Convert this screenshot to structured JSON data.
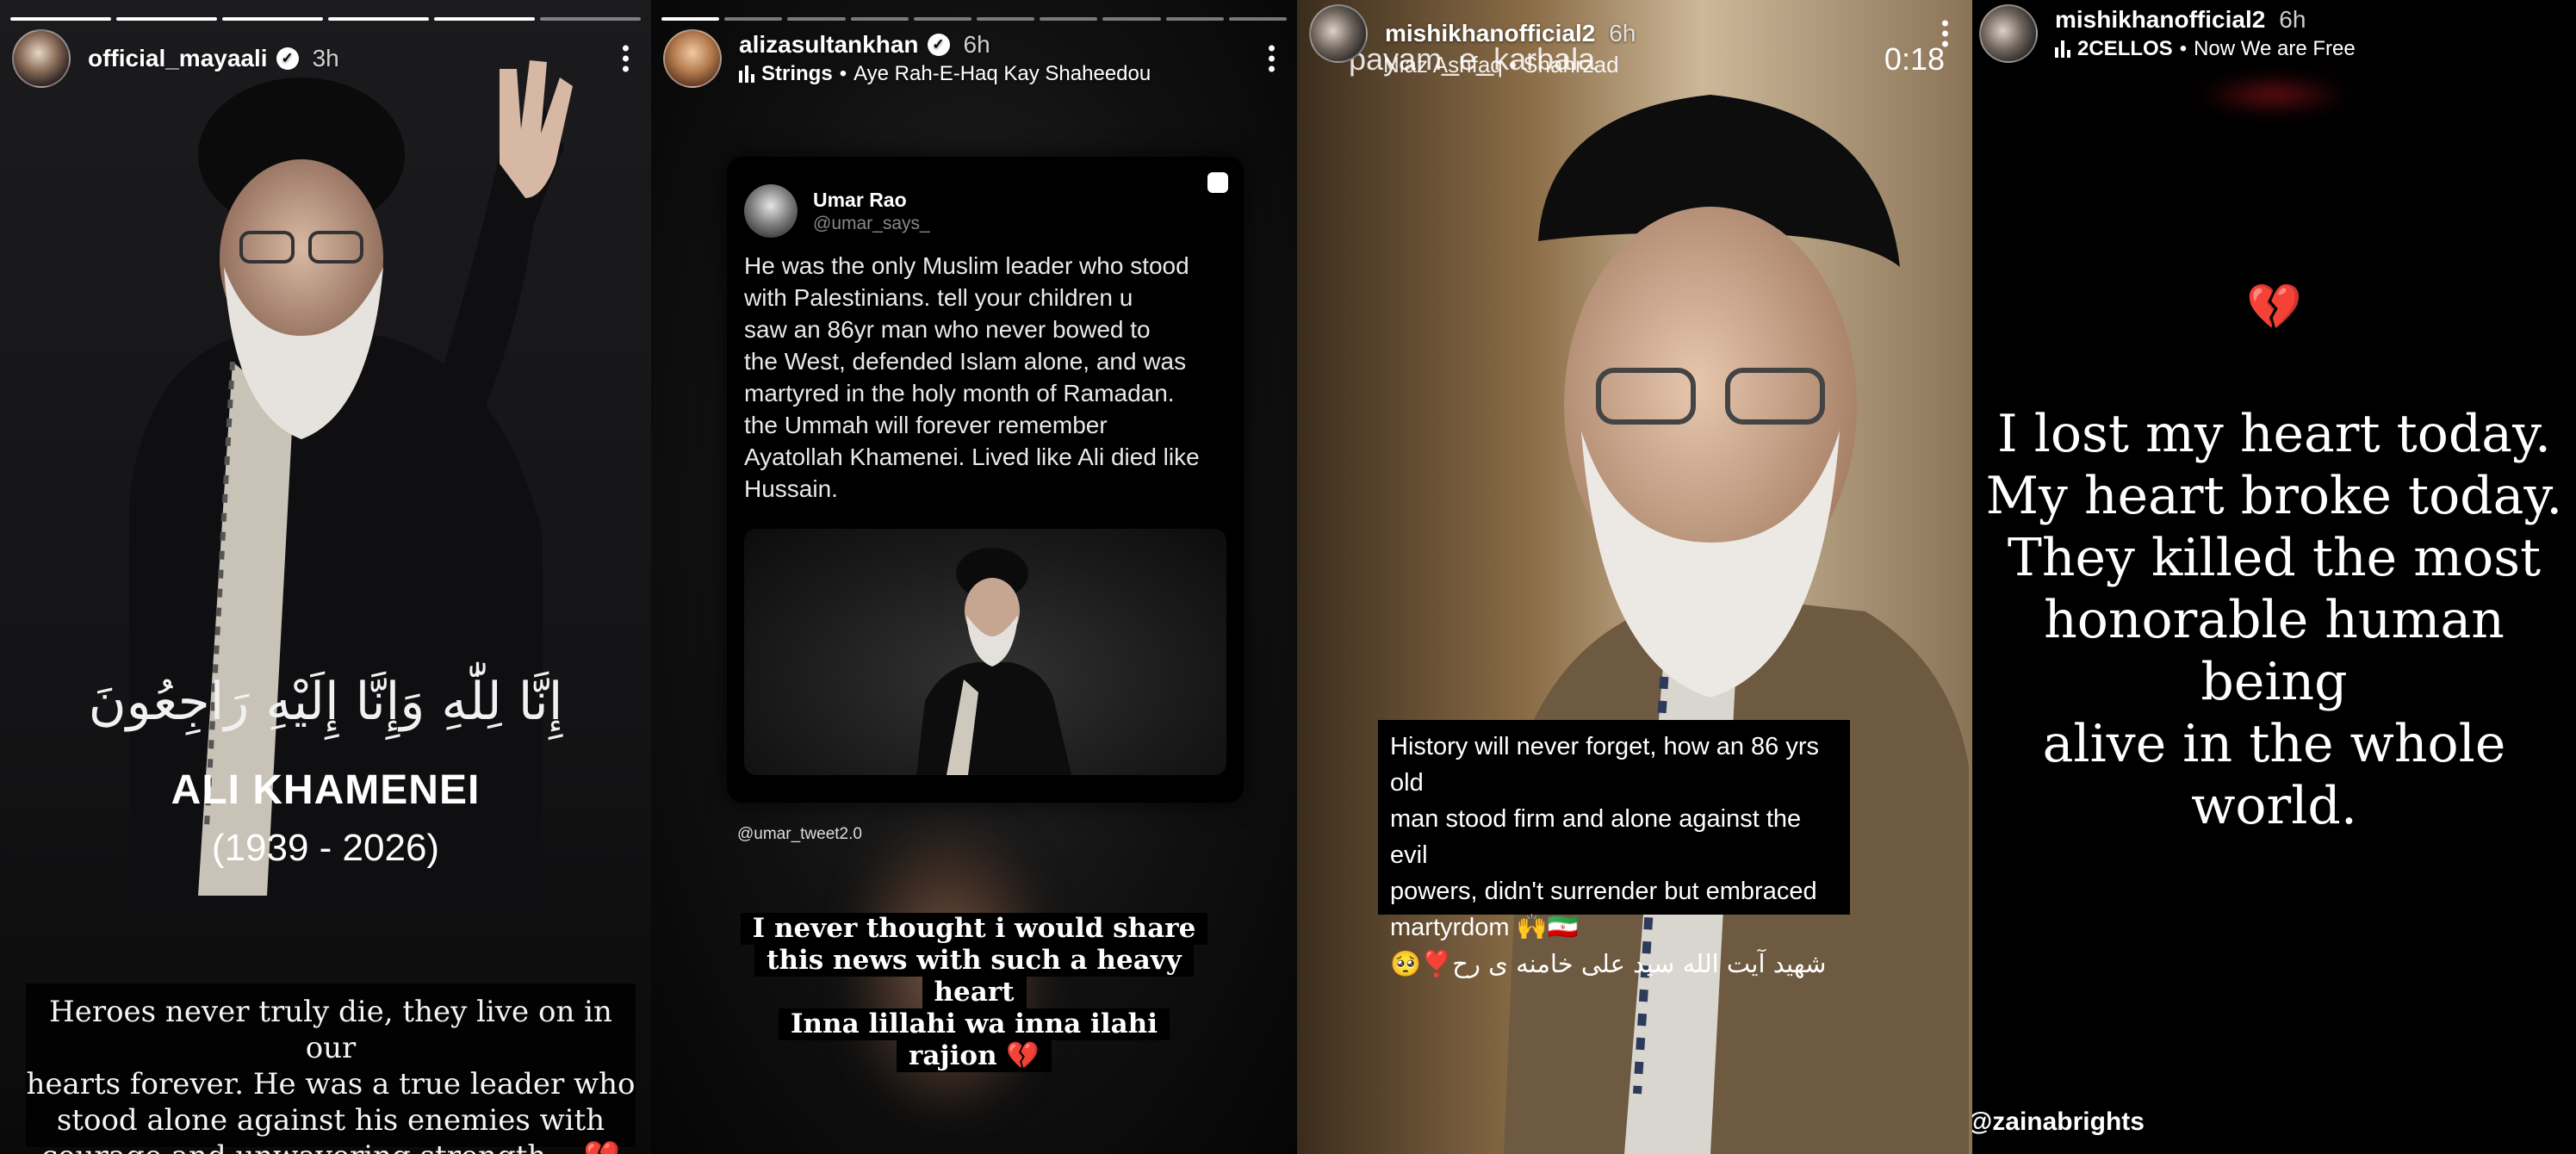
{
  "panel1": {
    "username": "official_mayaali",
    "time": "3h",
    "arabic_text": "إِنَّا لِلّٰهِ وَإِنَّا إِلَيْهِ رَاجِعُونَ",
    "name": "ALI KHAMENEI",
    "years": "(1939 - 2026)",
    "caption_lines": [
      "Heroes never truly die, they live on in our",
      "hearts forever. He was a true leader who",
      "stood alone against his enemies with",
      "courage and unwavering strength... 💔💔"
    ]
  },
  "panel2": {
    "username": "alizasultankhan",
    "time": "6h",
    "music_artist": "Strings",
    "music_sep": "•",
    "music_title": "Aye Rah-E-Haq Kay Shaheedou",
    "tweet": {
      "name": "Umar Rao",
      "handle": "@umar_says_",
      "text_lines": [
        "He was the only Muslim leader who stood",
        "with Palestinians. tell your children u",
        "saw an 86yr man who never bowed to",
        "the West, defended Islam alone, and was",
        "martyred in the holy month of Ramadan.",
        "the Ummah will forever remember",
        "Ayatollah Khamenei. Lived like Ali died like",
        "Hussain."
      ]
    },
    "credit": "@umar_tweet2.0",
    "overlay_lines": [
      "I never thought i would share",
      "this news with such a heavy",
      "heart",
      "Inna lillahi wa inna ilahi",
      "rajion 💔"
    ]
  },
  "panel3": {
    "username": "mishikhanofficial2",
    "time": "6h",
    "overlay_title": "payam_e_karbala",
    "overlay_sub": "Niaz Ashfaq • Shahrzad",
    "timer": "0:18",
    "caption_lines": [
      "History will never forget, how an 86 yrs old",
      "man stood firm and alone against the evil",
      "powers, didn't surrender but embraced",
      "martyrdom 🙌🇮🇷"
    ],
    "urdu_line": "شهید آیت الله سید علی خامنه ی رح❣️🥺"
  },
  "panel4": {
    "username": "mishikhanofficial2",
    "time": "6h",
    "music_artist": "2CELLOS",
    "music_sep": "•",
    "music_title": "Now We are Free",
    "heart": "💔",
    "text_lines": [
      "I lost my heart today.",
      "My heart broke today.",
      "They killed the most",
      "honorable human being",
      "alive in the whole world."
    ],
    "handle": "@zainabrights"
  }
}
